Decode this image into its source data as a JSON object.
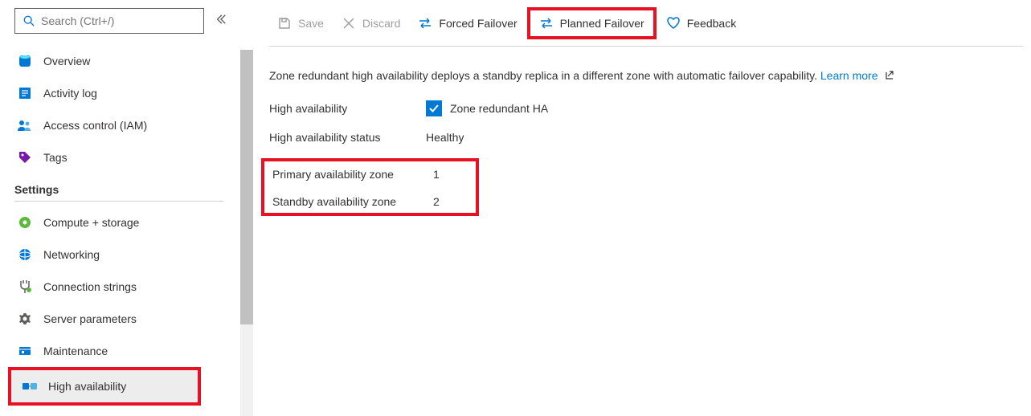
{
  "sidebar": {
    "search_placeholder": "Search (Ctrl+/)",
    "items_top": [
      {
        "label": "Overview",
        "icon": "overview"
      },
      {
        "label": "Activity log",
        "icon": "activity-log"
      },
      {
        "label": "Access control (IAM)",
        "icon": "access-control"
      },
      {
        "label": "Tags",
        "icon": "tags"
      }
    ],
    "settings_header": "Settings",
    "items_settings": [
      {
        "label": "Compute + storage",
        "icon": "compute"
      },
      {
        "label": "Networking",
        "icon": "networking"
      },
      {
        "label": "Connection strings",
        "icon": "connection"
      },
      {
        "label": "Server parameters",
        "icon": "parameters"
      },
      {
        "label": "Maintenance",
        "icon": "maintenance"
      },
      {
        "label": "High availability",
        "icon": "high-availability",
        "active": true
      }
    ]
  },
  "toolbar": {
    "save_label": "Save",
    "discard_label": "Discard",
    "forced_failover_label": "Forced Failover",
    "planned_failover_label": "Planned Failover",
    "feedback_label": "Feedback"
  },
  "main": {
    "description": "Zone redundant high availability deploys a standby replica in a different zone with automatic failover capability.",
    "learn_more_label": "Learn more",
    "rows": {
      "ha_label": "High availability",
      "ha_value": "Zone redundant HA",
      "ha_status_label": "High availability status",
      "ha_status_value": "Healthy",
      "primary_zone_label": "Primary availability zone",
      "primary_zone_value": "1",
      "standby_zone_label": "Standby availability zone",
      "standby_zone_value": "2"
    }
  }
}
